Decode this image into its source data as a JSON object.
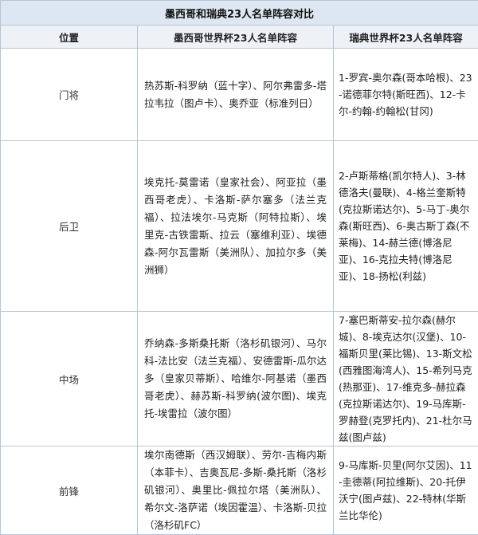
{
  "title": "墨西哥和瑞典23人名单阵容对比",
  "headers": {
    "position": "位置",
    "mexico": "墨西哥世界杯23人名单阵容",
    "sweden": "瑞典世界杯23人名单阵容"
  },
  "rows": [
    {
      "position": "门将",
      "mexico": "热苏斯-科罗纳（蓝十字）、阿尔弗雷多-塔拉韦拉（图卢卡）、奥乔亚（标准列日）",
      "sweden": "1-罗宾-奥尔森(哥本哈根)、23-诺德菲尔特(斯旺西)、12-卡尔-约翰-约翰松(甘冈)"
    },
    {
      "position": "后卫",
      "mexico": "埃克托-莫雷诺（皇家社会）、阿亚拉（墨西哥老虎）、卡洛斯-萨尔塞多（法兰克福）、拉法埃尔-马克斯（阿特拉斯）、埃里克-古铁雷斯、拉云（塞维利亚）、埃德森-阿尔瓦雷斯（美洲队）、加拉尔多（美洲狮）",
      "sweden": "2-卢斯蒂格(凯尔特人)、3-林德洛夫(曼联)、4-格兰奎斯特(克拉斯诺达尔)、5-马丁-奥尔森(斯旺西)、6-奥古斯丁森(不莱梅)、14-赫兰德(博洛尼亚)、16-克拉夫特(博洛尼亚)、18-扬松(利兹)"
    },
    {
      "position": "中场",
      "mexico": "乔纳森-多斯桑托斯（洛杉矶银河）、马尔科-法比安（法兰克福）、安德雷斯-瓜尔达多（皇家贝蒂斯）、哈维尔-阿基诺（墨西哥老虎）、赫苏斯-科罗纳(波尔图)、埃克托-埃雷拉（波尔图）",
      "sweden": "7-塞巴斯蒂安-拉尔森(赫尔城)、8-埃克达尔(汉堡)、10-福斯贝里(莱比锡)、13-斯文松(西雅图海湾人)、15-希列马克(热那亚)、17-维克多-赫拉森(克拉斯诺达尔)、19-马库斯-罗赫登(克罗托内)、21-杜尔马兹(图卢兹)"
    },
    {
      "position": "前锋",
      "mexico": "埃尔南德斯（西汉姆联）、劳尔-吉梅内斯（本菲卡）、吉奥瓦尼-多斯-桑托斯（洛杉矶银河）、奥里比-佩拉尔塔（美洲队）、希尔文-洛萨诺（埃因霍温）、卡洛斯-贝拉（洛杉矶FC）",
      "sweden": "9-马库斯-贝里(阿尔艾因)、11-圭德蒂(阿拉维斯)、20-托伊沃宁(图卢兹)、22-特林(华斯兰比华伦)"
    }
  ]
}
